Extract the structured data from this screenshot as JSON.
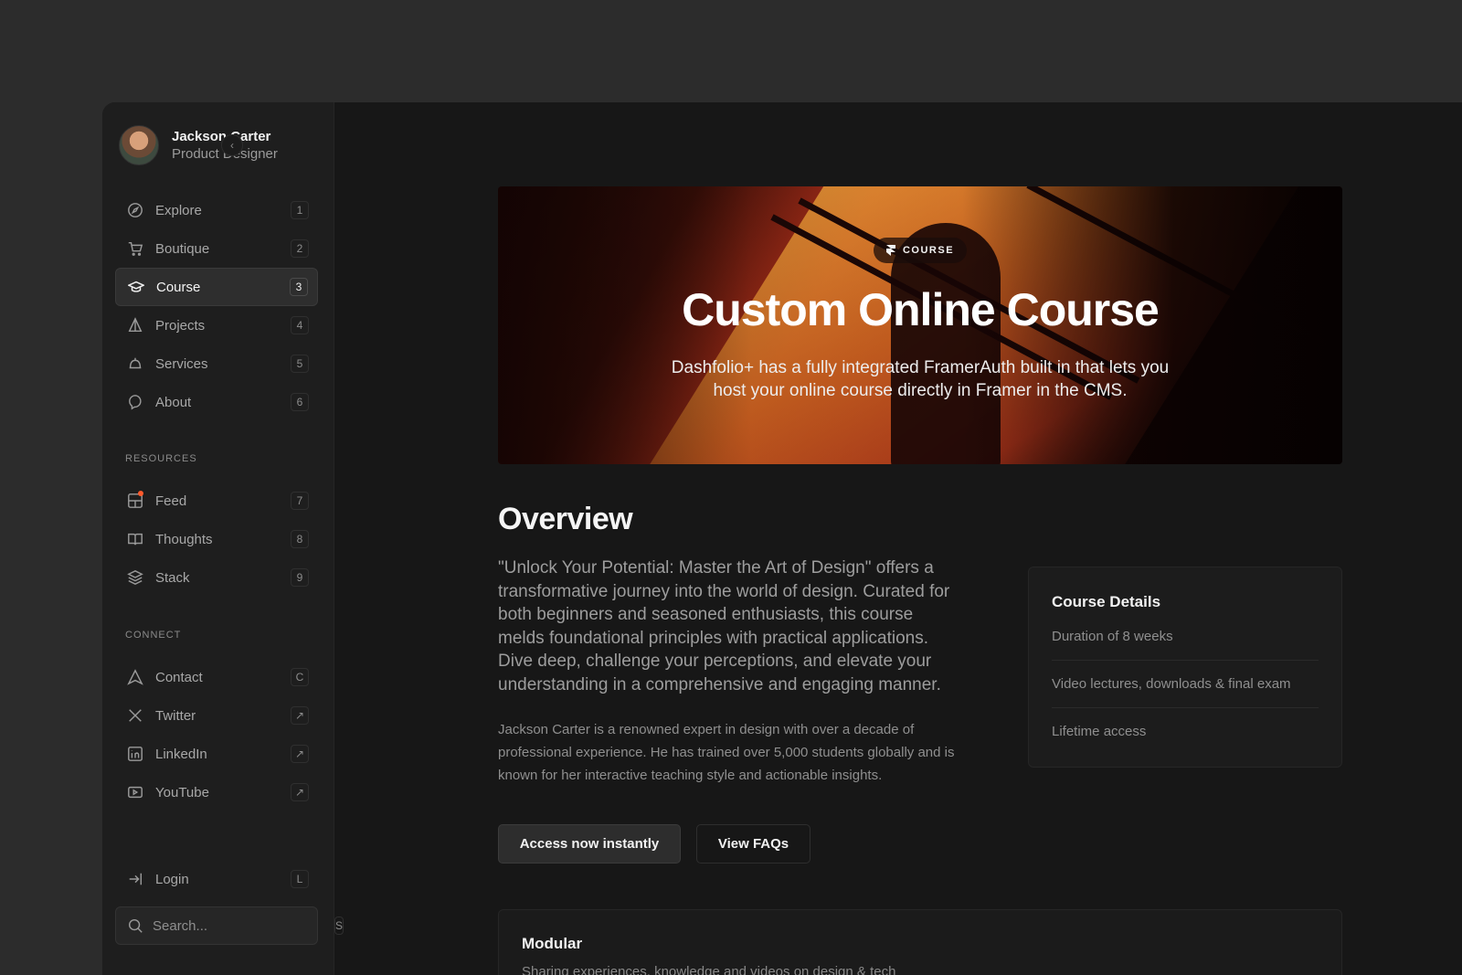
{
  "profile": {
    "name": "Jackson Carter",
    "role": "Product Designer",
    "collapse_icon": "chevron-left-icon"
  },
  "nav": {
    "main": [
      {
        "label": "Explore",
        "key": "1",
        "icon": "compass-icon"
      },
      {
        "label": "Boutique",
        "key": "2",
        "icon": "cart-icon"
      },
      {
        "label": "Course",
        "key": "3",
        "icon": "graduation-cap-icon",
        "active": true
      },
      {
        "label": "Projects",
        "key": "4",
        "icon": "shapes-icon"
      },
      {
        "label": "Services",
        "key": "5",
        "icon": "bell-icon"
      },
      {
        "label": "About",
        "key": "6",
        "icon": "chat-bubble-icon"
      }
    ],
    "resources_label": "RESOURCES",
    "resources": [
      {
        "label": "Feed",
        "key": "7",
        "icon": "layout-icon"
      },
      {
        "label": "Thoughts",
        "key": "8",
        "icon": "book-icon"
      },
      {
        "label": "Stack",
        "key": "9",
        "icon": "layers-icon"
      }
    ],
    "connect_label": "CONNECT",
    "connect": [
      {
        "label": "Contact",
        "key": "C",
        "icon": "send-icon"
      },
      {
        "label": "Twitter",
        "key": "↗",
        "icon": "x-logo-icon"
      },
      {
        "label": "LinkedIn",
        "key": "↗",
        "icon": "linkedin-icon"
      },
      {
        "label": "YouTube",
        "key": "↗",
        "icon": "youtube-icon"
      }
    ],
    "login": {
      "label": "Login",
      "key": "L",
      "icon": "login-arrow-icon"
    },
    "search": {
      "placeholder": "Search...",
      "key": "S"
    }
  },
  "hero": {
    "badge": "COURSE",
    "title": "Custom Online Course",
    "subtitle": "Dashfolio+ has a fully integrated FramerAuth built in that lets you host your online course directly in Framer in the CMS."
  },
  "overview": {
    "title": "Overview",
    "lead": "\"Unlock Your Potential: Master the Art of Design\" offers a transformative journey into the world of design. Curated for both beginners and seasoned enthusiasts, this course melds foundational principles with practical applications. Dive deep, challenge your perceptions, and elevate your understanding in a comprehensive and engaging manner.",
    "body": "Jackson Carter is a renowned expert in design with over a decade of professional experience. He has trained over 5,000 students globally and is known for her interactive teaching style and actionable insights."
  },
  "course_details": {
    "title": "Course Details",
    "items": [
      "Duration of 8 weeks",
      "Video lectures, downloads & final exam",
      "Lifetime access"
    ]
  },
  "actions": {
    "primary": "Access now instantly",
    "secondary": "View FAQs"
  },
  "modular": {
    "title": "Modular",
    "subtitle": "Sharing experiences, knowledge and videos on design & tech"
  },
  "colors": {
    "accent_dot": "#ff5a2c",
    "background": "#171717",
    "sidebar": "#1e1e1e"
  }
}
